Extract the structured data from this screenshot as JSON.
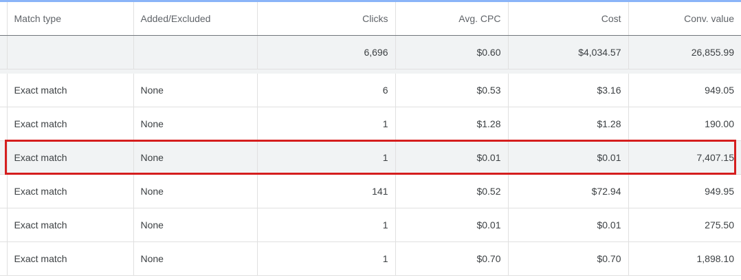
{
  "colors": {
    "highlight_border": "#d51e1e",
    "top_accent": "#8ab4f8",
    "total_row_bg": "#f1f3f4"
  },
  "columns": {
    "match_type": "Match type",
    "added_excluded": "Added/Excluded",
    "clicks": "Clicks",
    "avg_cpc": "Avg. CPC",
    "cost": "Cost",
    "conv_value": "Conv. value"
  },
  "totals": {
    "match_type": "",
    "added_excluded": "",
    "clicks": "6,696",
    "avg_cpc": "$0.60",
    "cost": "$4,034.57",
    "conv_value": "26,855.99"
  },
  "rows": [
    {
      "match_type": "Exact match",
      "added_excluded": "None",
      "clicks": "6",
      "avg_cpc": "$0.53",
      "cost": "$3.16",
      "conv_value": "949.05"
    },
    {
      "match_type": "Exact match",
      "added_excluded": "None",
      "clicks": "1",
      "avg_cpc": "$1.28",
      "cost": "$1.28",
      "conv_value": "190.00"
    },
    {
      "match_type": "Exact match",
      "added_excluded": "None",
      "clicks": "1",
      "avg_cpc": "$0.01",
      "cost": "$0.01",
      "conv_value": "7,407.15",
      "highlighted": true
    },
    {
      "match_type": "Exact match",
      "added_excluded": "None",
      "clicks": "141",
      "avg_cpc": "$0.52",
      "cost": "$72.94",
      "conv_value": "949.95"
    },
    {
      "match_type": "Exact match",
      "added_excluded": "None",
      "clicks": "1",
      "avg_cpc": "$0.01",
      "cost": "$0.01",
      "conv_value": "275.50"
    },
    {
      "match_type": "Exact match",
      "added_excluded": "None",
      "clicks": "1",
      "avg_cpc": "$0.70",
      "cost": "$0.70",
      "conv_value": "1,898.10"
    }
  ]
}
